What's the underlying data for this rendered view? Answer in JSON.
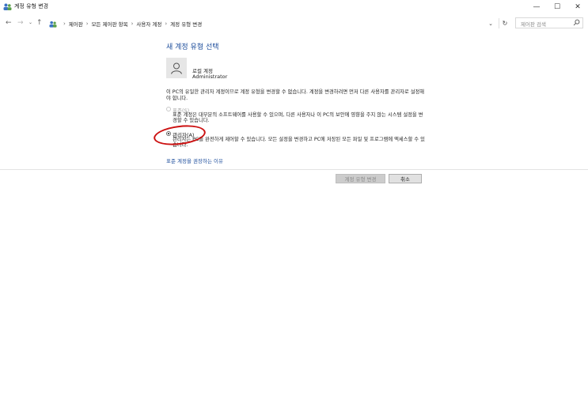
{
  "window": {
    "title": "계정 유형 변경",
    "controls": {
      "minimize": "—",
      "maximize": "☐",
      "close": "✕"
    }
  },
  "address_bar": {
    "breadcrumbs": [
      "제어판",
      "모든 제어판 항목",
      "사용자 계정",
      "계정 유형 변경"
    ],
    "search_placeholder": "제어판 검색"
  },
  "main": {
    "heading": "새 계정 유형 선택",
    "account": {
      "name": "로컬 계정",
      "type": "Administrator"
    },
    "description": "이 PC의 유일한 관리자 계정이므로 계정 유형을 변경할 수 없습니다. 계정을 변경하려면 먼저 다른 사용자를 관리자로 설정해야 합니다.",
    "options": [
      {
        "label": "표준(S)",
        "description": "표준 계정은 대부분의 소프트웨어를 사용할 수 있으며, 다른 사용자나 이 PC의 보안에 영향을 주지 않는 시스템 설정을 변경할 수 있습니다.",
        "selected": false,
        "enabled": false
      },
      {
        "label": "관리자(A)",
        "description": "관리자는 PC를 완전하게 제어할 수 있습니다. 모든 설정을 변경하고 PC에 저장된 모든 파일 및 프로그램에 액세스할 수 있습니다.",
        "selected": true,
        "enabled": true
      }
    ],
    "recommend_link": "표준 계정을 권장하는 이유",
    "buttons": {
      "change": "계정 유형 변경",
      "cancel": "취소"
    }
  },
  "colors": {
    "heading": "#1e4e9c",
    "link": "#1e4e9c",
    "annotation": "#cc1111"
  }
}
